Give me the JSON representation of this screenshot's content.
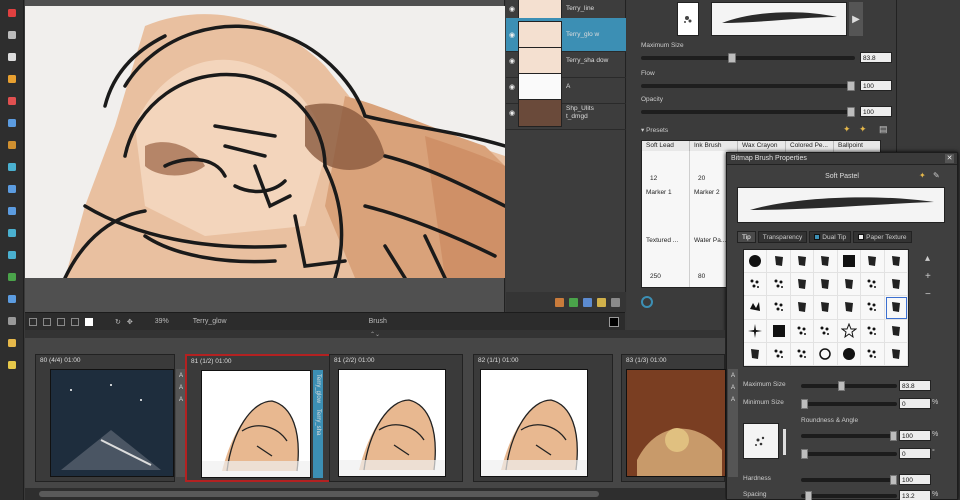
{
  "tools": [
    "brush-tool",
    "pencil-tool",
    "text-tool",
    "eraser-tool",
    "paint-tool",
    "select-rect-tool",
    "dropper-tool",
    "globe-tool",
    "crop-tool",
    "transform-tool",
    "stamp-tool",
    "fill-tool",
    "clone-tool",
    "layer-tool",
    "trash-tool",
    "paint-bucket-tool",
    "bulb-tool"
  ],
  "layers": [
    {
      "name": "Terry_line",
      "selected": false
    },
    {
      "name": "Terry_glo w",
      "selected": true
    },
    {
      "name": "Terry_sha dow",
      "selected": false
    },
    {
      "name": "A",
      "selected": false
    },
    {
      "name": "Shp_Ulits t_dmgd",
      "selected": false
    }
  ],
  "status": {
    "zoom": "39%",
    "layer": "Terry_glow",
    "tool": "Brush"
  },
  "brush": {
    "max_size_label": "Maximum Size",
    "max_size_value": "83.8",
    "max_size_level": 0.42,
    "flow_label": "Flow",
    "flow_value": "100",
    "flow_level": 1.0,
    "opacity_label": "Opacity",
    "opacity_value": "100",
    "opacity_level": 1.0,
    "presets_label": "Presets",
    "preset_columns": [
      {
        "name": "Soft Lead",
        "n1": "12"
      },
      {
        "name": "Ink Brush",
        "n1": "20"
      },
      {
        "name": "Wax Crayon",
        "n1": ""
      },
      {
        "name": "Colored Pe...",
        "n1": ""
      },
      {
        "name": "Ballpoint",
        "n1": ""
      }
    ],
    "preset_rows": [
      "Marker 1",
      "Marker 2"
    ],
    "preset_row3": [
      "Textured ...",
      "Water Pa..."
    ],
    "preset_nums": [
      "250",
      "80"
    ]
  },
  "dialog": {
    "title": "Bitmap Brush Properties",
    "brush_name": "Soft Pastel",
    "tabs": [
      "Tip",
      "Transparency",
      "Dual Tip",
      "Paper Texture"
    ],
    "max_size_label": "Maximum Size",
    "max_size_value": "83.8",
    "max_size_level": 0.42,
    "min_size_label": "Minimum Size",
    "min_size_value": "0",
    "min_size_unit": "%",
    "min_size_level": 0.0,
    "roundness_label": "Roundness & Angle",
    "roundness_value": "100",
    "roundness_unit": "%",
    "roundness_level": 1.0,
    "angle_value": "0",
    "angle_unit": "°",
    "angle_level": 0.0,
    "hardness_label": "Hardness",
    "hardness_value": "100",
    "hardness_level": 1.0,
    "spacing_label": "Spacing",
    "spacing_value": "13.2",
    "spacing_unit": "%",
    "spacing_level": 0.04
  },
  "storyboard": [
    {
      "title": "80 (4/4) 01:00",
      "selected": false
    },
    {
      "title": "81 (1/2) 01:00",
      "selected": true,
      "side_label": "Terry_glow",
      "side_label2": "Terry_sha"
    },
    {
      "title": "81 (2/2) 01:00",
      "selected": false
    },
    {
      "title": "82 (1/1) 01:00",
      "selected": false
    },
    {
      "title": "83 (1/3) 01:00",
      "selected": false
    }
  ],
  "colors": {
    "accent": "#3c8fb4",
    "selected_panel": "#b32121",
    "skin": "#e8a87c"
  }
}
